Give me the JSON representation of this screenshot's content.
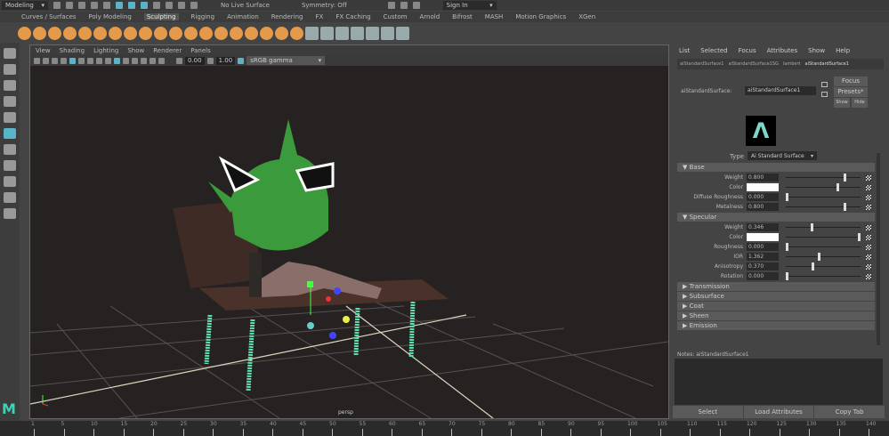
{
  "topbar": {
    "workspace": "Modeling",
    "live_surface": "No Live Surface",
    "symmetry": "Symmetry: Off",
    "sign_in": "Sign In"
  },
  "shelf_tabs": [
    "Curves / Surfaces",
    "Poly Modeling",
    "Sculpting",
    "Rigging",
    "Animation",
    "Rendering",
    "FX",
    "FX Caching",
    "Custom",
    "Arnold",
    "Bifrost",
    "MASH",
    "Motion Graphics",
    "XGen"
  ],
  "shelf_active": "Sculpting",
  "viewport": {
    "menu": [
      "View",
      "Shading",
      "Lighting",
      "Show",
      "Renderer",
      "Panels"
    ],
    "exposure": "0.00",
    "gamma": "1.00",
    "color_space": "sRGB gamma",
    "camera_label": "persp"
  },
  "attribute_editor": {
    "menu": [
      "List",
      "Selected",
      "Focus",
      "Attributes",
      "Show",
      "Help"
    ],
    "tabs": [
      "aiStandardSurface1",
      "aiStandardSurface1SG",
      "lambert",
      "aiStandardSurface1"
    ],
    "node_type_label": "aiStandardSurface:",
    "node_name": "aiStandardSurface1",
    "focus": "Focus",
    "presets": "Presets*",
    "show": "Show",
    "hide": "Hide",
    "type_label": "Type",
    "type_value": "Ai Standard Surface",
    "accent": "#7fd6c8",
    "sections": [
      {
        "title": "Base",
        "expanded": true,
        "rows": [
          {
            "label": "Weight",
            "value": "0.800",
            "slider": 0.8
          },
          {
            "label": "Color",
            "value": "",
            "color": "#ffffff",
            "slider": 0.7
          },
          {
            "label": "Diffuse Roughness",
            "value": "0.000",
            "slider": 0
          },
          {
            "label": "Metalness",
            "value": "0.800",
            "slider": 0.8
          }
        ]
      },
      {
        "title": "Specular",
        "expanded": true,
        "rows": [
          {
            "label": "Weight",
            "value": "0.346",
            "slider": 0.35
          },
          {
            "label": "Color",
            "value": "",
            "color": "#ffffff",
            "slider": 1
          },
          {
            "label": "Roughness",
            "value": "0.000",
            "slider": 0
          },
          {
            "label": "IOR",
            "value": "1.362",
            "slider": 0.45
          },
          {
            "label": "Anisotropy",
            "value": "0.370",
            "slider": 0.36
          },
          {
            "label": "Rotation",
            "value": "0.000",
            "slider": 0
          }
        ]
      },
      {
        "title": "Transmission",
        "expanded": false
      },
      {
        "title": "Subsurface",
        "expanded": false
      },
      {
        "title": "Coat",
        "expanded": false
      },
      {
        "title": "Sheen",
        "expanded": false
      },
      {
        "title": "Emission",
        "expanded": false
      }
    ],
    "notes_label": "Notes: aiStandardSurface1",
    "buttons": [
      "Select",
      "Load Attributes",
      "Copy Tab"
    ]
  },
  "timeline": {
    "ticks": [
      "1",
      "5",
      "10",
      "15",
      "20",
      "25",
      "30",
      "35",
      "40",
      "45",
      "50",
      "55",
      "60",
      "65",
      "70",
      "75",
      "80",
      "85",
      "90",
      "95",
      "100",
      "105",
      "110",
      "115",
      "120",
      "125",
      "130",
      "135",
      "140"
    ]
  }
}
